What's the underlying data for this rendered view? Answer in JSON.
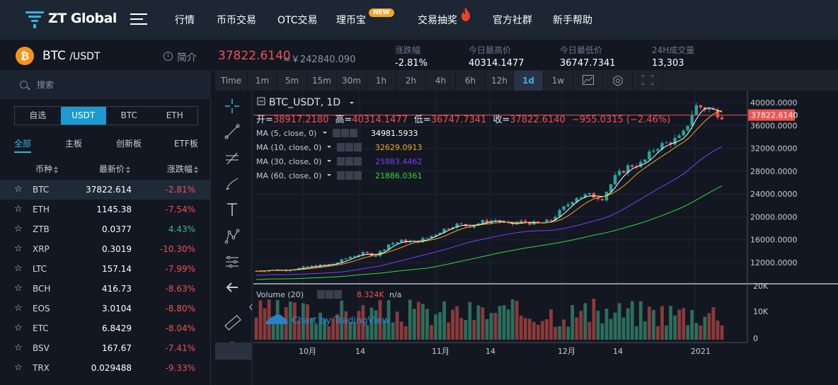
{
  "brand": {
    "name": "ZT Global"
  },
  "nav": {
    "items": [
      "行情",
      "币币交易",
      "OTC交易",
      "理币宝",
      "交易抽奖",
      "官方社群",
      "新手帮助"
    ],
    "badge": "NEW"
  },
  "ticker": {
    "symbol": "BTC",
    "quote": "/USDT",
    "intro": "简介",
    "price": "37822.6140",
    "cny": "≈￥242840.090",
    "stats": [
      {
        "label": "涨跌幅",
        "value": "-2.81%"
      },
      {
        "label": "今日最高价",
        "value": "40314.1477"
      },
      {
        "label": "今日最低价",
        "value": "36747.7341"
      },
      {
        "label": "24H成交量",
        "value": "13,303"
      }
    ]
  },
  "sidebar": {
    "search_placeholder": "搜索",
    "quote_tabs": [
      "自选",
      "USDT",
      "BTC",
      "ETH"
    ],
    "market_tabs": [
      "全部",
      "主板",
      "创新板",
      "ETF板"
    ],
    "headers": [
      "币种",
      "最新价",
      "涨跌幅"
    ],
    "rows": [
      {
        "name": "BTC",
        "price": "37822.614",
        "change": "-2.81%"
      },
      {
        "name": "ETH",
        "price": "1145.38",
        "change": "-7.54%"
      },
      {
        "name": "ZTB",
        "price": "0.0377",
        "change": "4.43%"
      },
      {
        "name": "XRP",
        "price": "0.3019",
        "change": "-10.30%"
      },
      {
        "name": "LTC",
        "price": "157.14",
        "change": "-7.99%"
      },
      {
        "name": "BCH",
        "price": "416.73",
        "change": "-8.63%"
      },
      {
        "name": "EOS",
        "price": "3.0104",
        "change": "-8.80%"
      },
      {
        "name": "ETC",
        "price": "6.8429",
        "change": "-8.04%"
      },
      {
        "name": "BSV",
        "price": "167.67",
        "change": "-7.41%"
      },
      {
        "name": "TRX",
        "price": "0.029488",
        "change": "-9.33%"
      }
    ]
  },
  "chart_toolbar": {
    "intervals": [
      "Time",
      "1m",
      "5m",
      "15m",
      "30m",
      "1h",
      "2h",
      "4h",
      "6h",
      "12h",
      "1d",
      "1w"
    ],
    "active": "1d"
  },
  "chart": {
    "title": "BTC_USDT, 1D",
    "ohlc": {
      "open_label": "开=",
      "open": "38917.2180",
      "high_label": "高=",
      "high": "40314.1477",
      "low_label": "低=",
      "low": "36747.7341",
      "close_label": "收=",
      "close": "37822.6140",
      "change": "−955.0315 (−2.46%)"
    },
    "ma": [
      {
        "label": "MA (5, close, 0)",
        "value": "34981.5933",
        "color": "#ffffff"
      },
      {
        "label": "MA (10, close, 0)",
        "value": "32629.0913",
        "color": "#f5a623"
      },
      {
        "label": "MA (30, close, 0)",
        "value": "25883.4462",
        "color": "#7b3ff2"
      },
      {
        "label": "MA (60, close, 0)",
        "value": "21886.0361",
        "color": "#2fdc3c"
      }
    ],
    "volume_label": "Volume (20)",
    "volume_value": "8.324K",
    "volume_na": "n/a",
    "watermark": "Chart by TradingView",
    "price_axis": [
      "40000.0000",
      "36000.0000",
      "32000.0000",
      "28000.0000",
      "24000.0000",
      "20000.0000",
      "16000.0000",
      "12000.0000"
    ],
    "current_price": "37822.6140",
    "vol_axis": [
      "20K",
      "10K",
      "0"
    ],
    "x_axis": [
      "10月",
      "14",
      "11月",
      "14",
      "12月",
      "14",
      "2021"
    ]
  },
  "chart_data": {
    "type": "candlestick",
    "x_range": [
      "2020-09-23",
      "2021-01-11"
    ],
    "y_range": [
      10000,
      41000
    ],
    "closes_approx": [
      10500,
      10700,
      10650,
      10900,
      11300,
      11500,
      11900,
      13000,
      13600,
      13300,
      15300,
      15800,
      15600,
      16500,
      17700,
      18700,
      18400,
      19100,
      19400,
      18600,
      19200,
      18800,
      19200,
      21300,
      23500,
      23800,
      23300,
      27000,
      28900,
      29300,
      32200,
      33000,
      34000,
      39400,
      38900,
      37822
    ],
    "ma": {
      "MA5": 34981.5933,
      "MA10": 32629.0913,
      "MA30": 25883.4462,
      "MA60": 21886.0361
    }
  }
}
